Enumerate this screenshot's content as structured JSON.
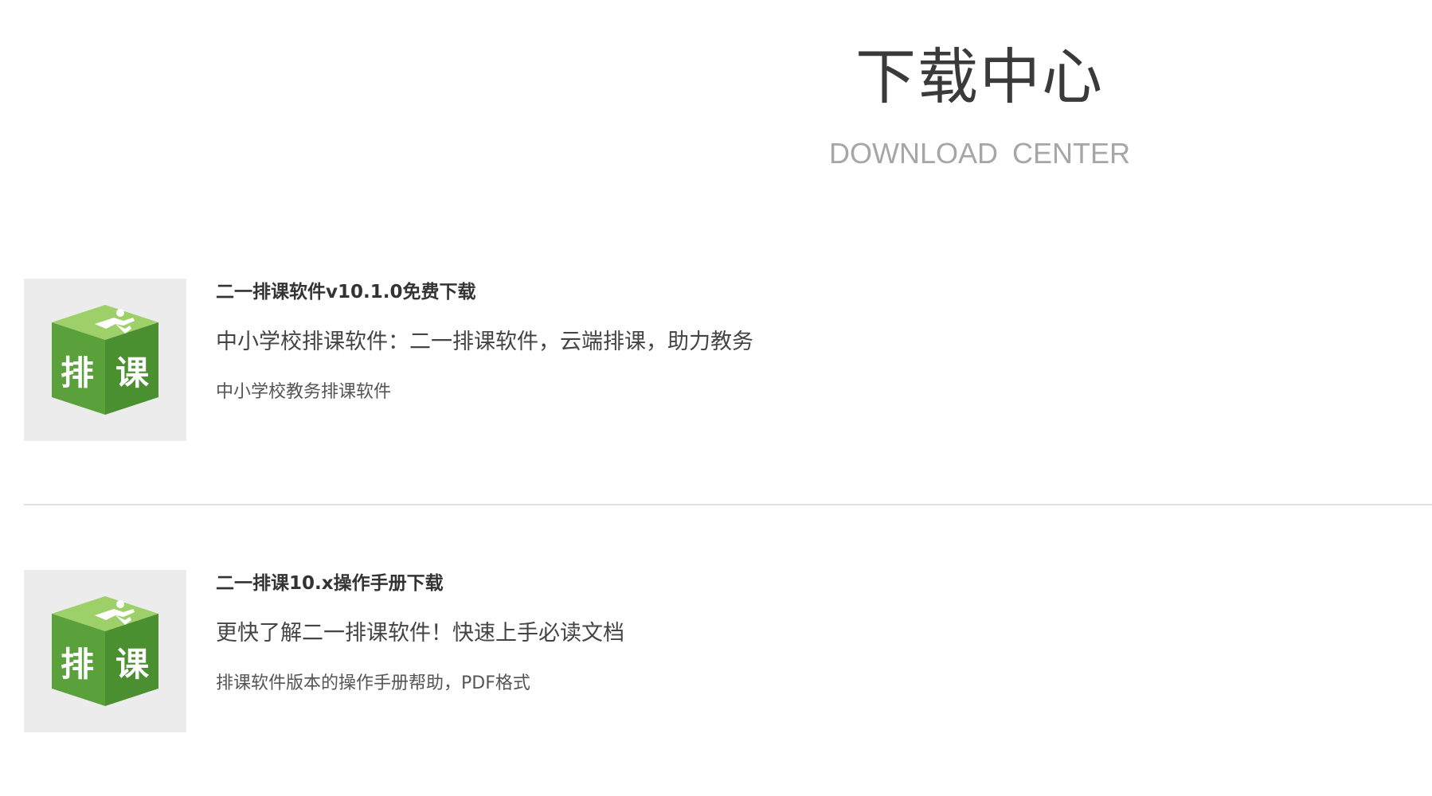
{
  "header": {
    "title": "下载中心",
    "subtitle": "DOWNLOAD  CENTER"
  },
  "downloads": [
    {
      "title": "二一排课软件v10.1.0免费下载",
      "description": "中小学校排课软件：二一排课软件，云端排课，助力教务",
      "note": "中小学校教务排课软件",
      "icon": "paike-cube-icon",
      "icon_text": [
        "排",
        "课"
      ]
    },
    {
      "title": "二一排课10.x操作手册下载",
      "description": "更快了解二一排课软件！快速上手必读文档",
      "note": "排课软件版本的操作手册帮助，PDF格式",
      "icon": "paike-cube-icon",
      "icon_text": [
        "排",
        "课"
      ]
    }
  ],
  "colors": {
    "icon_green_top": "#9ed06a",
    "icon_green_left": "#5aa13c",
    "icon_green_right": "#4a8f30",
    "thumb_bg": "#ececec",
    "divider": "#e1e1e1"
  }
}
